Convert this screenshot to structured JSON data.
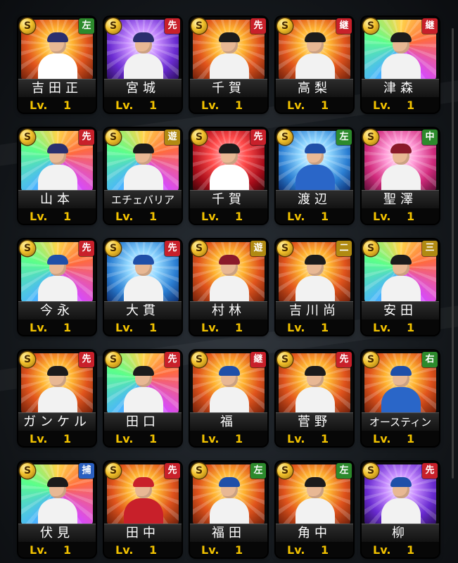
{
  "colors": {
    "pos_pitcher": "#c8202a",
    "pos_relief": "#c8202a",
    "pos_left": "#2c8a2c",
    "pos_center": "#2c8a2c",
    "pos_right": "#2c8a2c",
    "pos_short": "#b08a12",
    "pos_second": "#b08a12",
    "pos_third": "#b08a12",
    "pos_catcher": "#2a5fc0",
    "level": "#f2c200"
  },
  "coin_label": "S",
  "cards": [
    {
      "name": "吉田正",
      "position": "左",
      "pos_color": "#2c8a2c",
      "level_label": "Lv.",
      "level": "1",
      "art": "fire",
      "cap": "#2a2f6e",
      "uniform": "#ffffff"
    },
    {
      "name": "宮城",
      "position": "先",
      "pos_color": "#c8202a",
      "level_label": "Lv.",
      "level": "1",
      "art": "purple",
      "cap": "#2a2f6e",
      "uniform": "#f2f2f2"
    },
    {
      "name": "千賀",
      "position": "先",
      "pos_color": "#c8202a",
      "level_label": "Lv.",
      "level": "1",
      "art": "fire",
      "cap": "#1b1b1b",
      "uniform": "#f2f2f2"
    },
    {
      "name": "高梨",
      "position": "継",
      "pos_color": "#c8202a",
      "level_label": "Lv.",
      "level": "1",
      "art": "fire",
      "cap": "#1b1b1b",
      "uniform": "#f2f2f2"
    },
    {
      "name": "津森",
      "position": "継",
      "pos_color": "#c8202a",
      "level_label": "Lv.",
      "level": "1",
      "art": "rainbow",
      "cap": "#1b1b1b",
      "uniform": "#f2f2f2"
    },
    {
      "name": "山本",
      "position": "先",
      "pos_color": "#c8202a",
      "level_label": "Lv.",
      "level": "1",
      "art": "rainbow",
      "cap": "#2a2f6e",
      "uniform": "#f2f2f2"
    },
    {
      "name": "エチェバリア",
      "position": "遊",
      "pos_color": "#b08a12",
      "level_label": "Lv.",
      "level": "1",
      "art": "rainbow",
      "cap": "#1b1b1b",
      "uniform": "#f2f2f2"
    },
    {
      "name": "千賀",
      "position": "先",
      "pos_color": "#c8202a",
      "level_label": "Lv.",
      "level": "1",
      "art": "red",
      "cap": "#1b1b1b",
      "uniform": "#ffffff"
    },
    {
      "name": "渡辺",
      "position": "左",
      "pos_color": "#2c8a2c",
      "level_label": "Lv.",
      "level": "1",
      "art": "ice",
      "cap": "#1f4fa8",
      "uniform": "#2a66c8"
    },
    {
      "name": "聖澤",
      "position": "中",
      "pos_color": "#2c8a2c",
      "level_label": "Lv.",
      "level": "1",
      "art": "pink",
      "cap": "#8a1a2a",
      "uniform": "#f2f2f2"
    },
    {
      "name": "今永",
      "position": "先",
      "pos_color": "#c8202a",
      "level_label": "Lv.",
      "level": "1",
      "art": "rainbow",
      "cap": "#1f4fa8",
      "uniform": "#f2f2f2"
    },
    {
      "name": "大貫",
      "position": "先",
      "pos_color": "#c8202a",
      "level_label": "Lv.",
      "level": "1",
      "art": "ice",
      "cap": "#1f4fa8",
      "uniform": "#f2f2f2"
    },
    {
      "name": "村林",
      "position": "遊",
      "pos_color": "#b08a12",
      "level_label": "Lv.",
      "level": "1",
      "art": "fire",
      "cap": "#8a1a2a",
      "uniform": "#f2f2f2"
    },
    {
      "name": "吉川尚",
      "position": "二",
      "pos_color": "#b08a12",
      "level_label": "Lv.",
      "level": "1",
      "art": "fire",
      "cap": "#1b1b1b",
      "uniform": "#f2f2f2"
    },
    {
      "name": "安田",
      "position": "三",
      "pos_color": "#b08a12",
      "level_label": "Lv.",
      "level": "1",
      "art": "rainbow",
      "cap": "#1b1b1b",
      "uniform": "#f2f2f2"
    },
    {
      "name": "ガンケル",
      "position": "先",
      "pos_color": "#c8202a",
      "level_label": "Lv.",
      "level": "1",
      "art": "fire",
      "cap": "#1b1b1b",
      "uniform": "#f2f2f2"
    },
    {
      "name": "田口",
      "position": "先",
      "pos_color": "#c8202a",
      "level_label": "Lv.",
      "level": "1",
      "art": "rainbow",
      "cap": "#1b1b1b",
      "uniform": "#f2f2f2"
    },
    {
      "name": "福",
      "position": "継",
      "pos_color": "#c8202a",
      "level_label": "Lv.",
      "level": "1",
      "art": "fire",
      "cap": "#1f4fa8",
      "uniform": "#f2f2f2"
    },
    {
      "name": "菅野",
      "position": "先",
      "pos_color": "#c8202a",
      "level_label": "Lv.",
      "level": "1",
      "art": "fire",
      "cap": "#1b1b1b",
      "uniform": "#f2f2f2"
    },
    {
      "name": "オースティン",
      "position": "右",
      "pos_color": "#2c8a2c",
      "level_label": "Lv.",
      "level": "1",
      "art": "fire",
      "cap": "#1f4fa8",
      "uniform": "#2a66c8"
    },
    {
      "name": "伏見",
      "position": "捕",
      "pos_color": "#2a5fc0",
      "level_label": "Lv.",
      "level": "1",
      "art": "rainbow",
      "cap": "#1b1b1b",
      "uniform": "#f2f2f2"
    },
    {
      "name": "田中",
      "position": "先",
      "pos_color": "#c8202a",
      "level_label": "Lv.",
      "level": "1",
      "art": "fire",
      "cap": "#c8202a",
      "uniform": "#c8202a"
    },
    {
      "name": "福田",
      "position": "左",
      "pos_color": "#2c8a2c",
      "level_label": "Lv.",
      "level": "1",
      "art": "fire",
      "cap": "#1f4fa8",
      "uniform": "#f2f2f2"
    },
    {
      "name": "角中",
      "position": "左",
      "pos_color": "#2c8a2c",
      "level_label": "Lv.",
      "level": "1",
      "art": "fire",
      "cap": "#1b1b1b",
      "uniform": "#f2f2f2"
    },
    {
      "name": "柳",
      "position": "先",
      "pos_color": "#c8202a",
      "level_label": "Lv.",
      "level": "1",
      "art": "purple",
      "cap": "#1f4fa8",
      "uniform": "#f2f2f2"
    }
  ]
}
